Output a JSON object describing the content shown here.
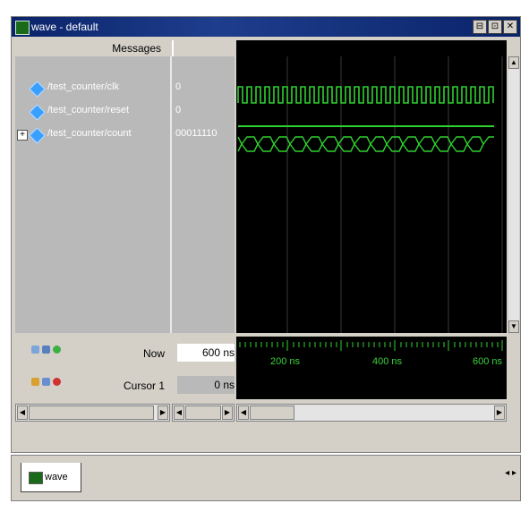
{
  "window": {
    "title": "wave - default",
    "controls": [
      "⊟",
      "⊡",
      "✕"
    ]
  },
  "columns": {
    "messages": "Messages"
  },
  "signals": [
    {
      "name": "/test_counter/clk",
      "value": "0"
    },
    {
      "name": "/test_counter/reset",
      "value": "0"
    },
    {
      "name": "/test_counter/count",
      "value": "00011110",
      "expand": "+"
    }
  ],
  "now": {
    "label": "Now",
    "value": "600 ns"
  },
  "cursor": {
    "label": "Cursor 1",
    "value": "0 ns"
  },
  "timeline": {
    "ticks": [
      "200 ns",
      "400 ns",
      "600 ns"
    ]
  },
  "tab": {
    "label": "wave",
    "nav": "◂ ▸"
  },
  "colors": {
    "wave": "#2fd12f",
    "background": "#000000",
    "titlebar": "#0a246a"
  }
}
